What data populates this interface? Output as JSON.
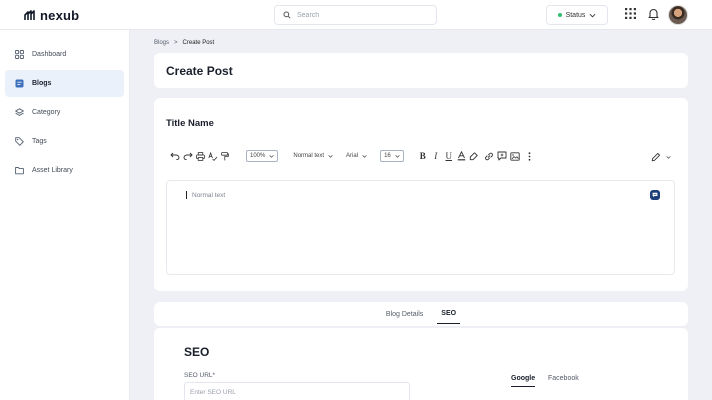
{
  "app": {
    "name": "nexub"
  },
  "header": {
    "search_placeholder": "Search",
    "status_label": "Status"
  },
  "sidebar": {
    "items": [
      {
        "label": "Dashboard",
        "icon": "grid-icon",
        "active": false
      },
      {
        "label": "Blogs",
        "icon": "blog-icon",
        "active": true
      },
      {
        "label": "Category",
        "icon": "layers-icon",
        "active": false
      },
      {
        "label": "Tags",
        "icon": "tag-icon",
        "active": false
      },
      {
        "label": "Asset Library",
        "icon": "folder-icon",
        "active": false
      }
    ]
  },
  "breadcrumb": {
    "parent": "Blogs",
    "separator": ">",
    "current": "Create Post"
  },
  "page": {
    "title": "Create Post"
  },
  "editor": {
    "section_title": "Title Name",
    "zoom": "100%",
    "block_style": "Normal text",
    "font": "Arial",
    "font_size": "16",
    "placeholder": "Normal text"
  },
  "tabs": {
    "items": [
      "Blog Details",
      "SEO"
    ],
    "active": "SEO"
  },
  "seo": {
    "title": "SEO",
    "url_label": "SEO URL*",
    "url_placeholder": "Enter SEO URL",
    "preview_tabs": [
      "Google",
      "Facebook"
    ],
    "preview_active": "Google"
  },
  "colors": {
    "accent": "#1d3f78",
    "status_dot": "#2fbf71",
    "active_nav_bg": "#eaf1fb",
    "page_bg": "#eef0f5"
  }
}
